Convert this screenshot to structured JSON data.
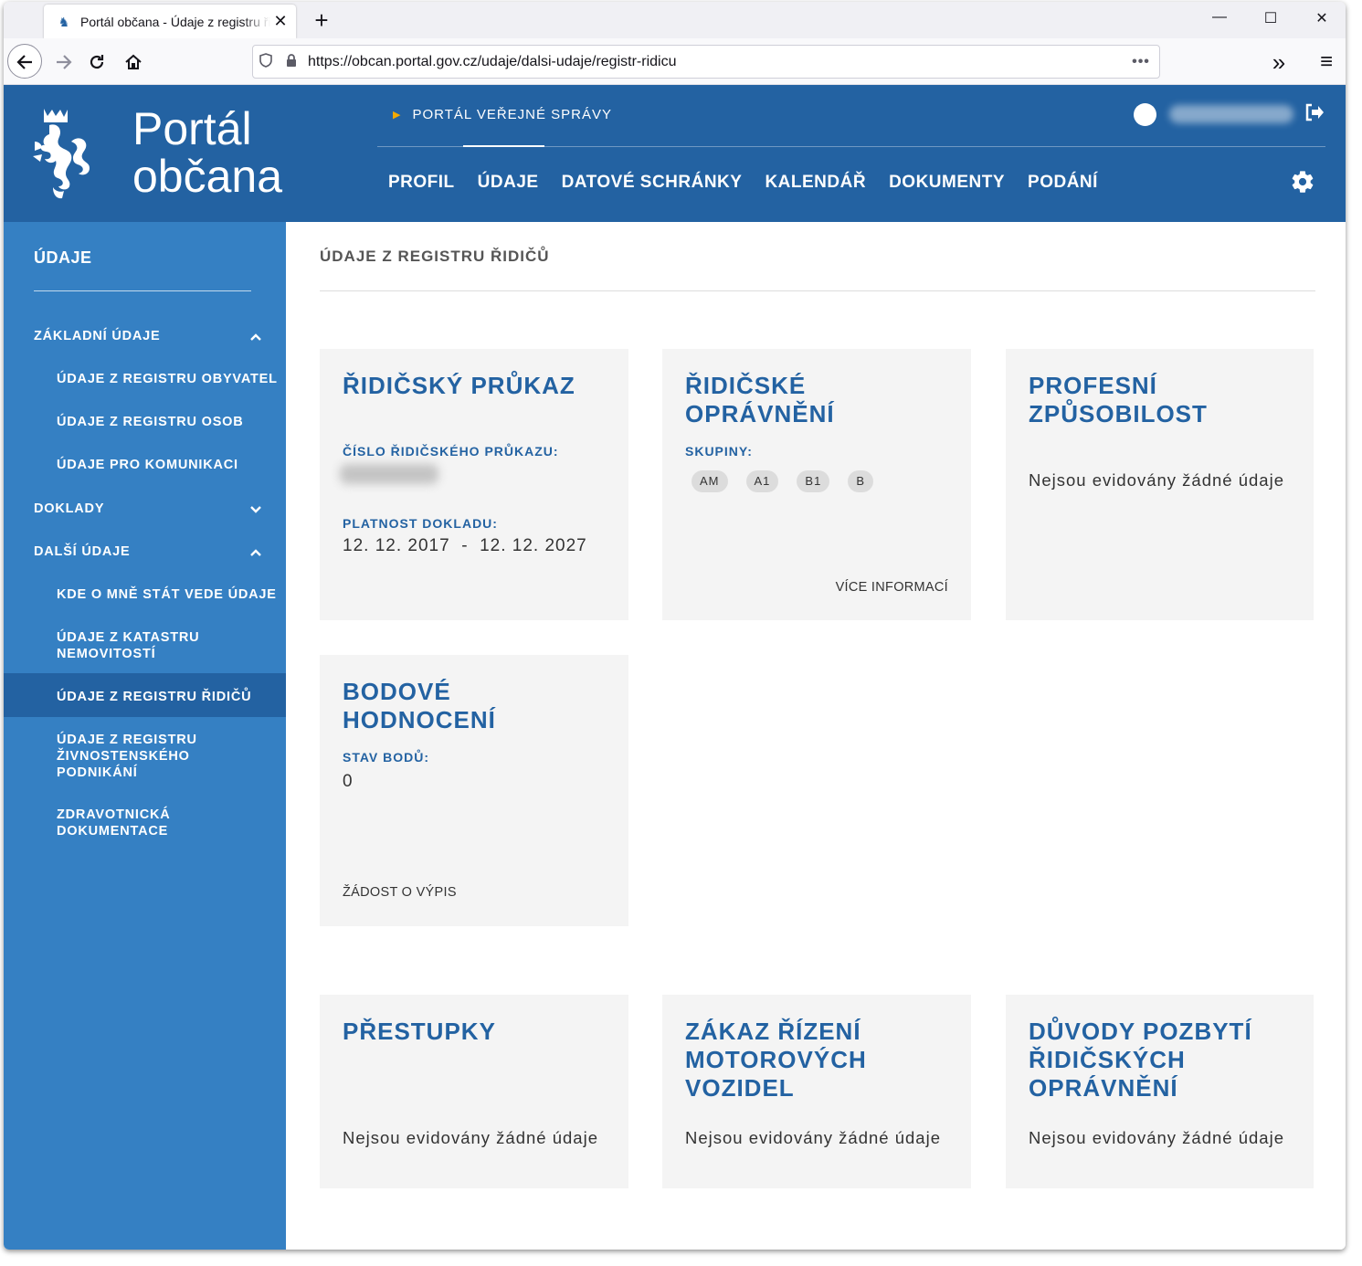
{
  "browser": {
    "tab_title": "Portál občana - Údaje z registru řidičů",
    "new_tab": "+",
    "close_tab": "✕",
    "url": "https://obcan.portal.gov.cz/udaje/dalsi-udaje/registr-ridicu",
    "url_menu": "•••",
    "overflow": "»",
    "menu": "≡",
    "win_min": "—",
    "win_max": "☐",
    "win_close": "✕"
  },
  "header": {
    "logo_line1": "Portál",
    "logo_line2": "občana",
    "portal_link": "PORTÁL VEŘEJNÉ SPRÁVY",
    "nav": [
      "PROFIL",
      "ÚDAJE",
      "DATOVÉ SCHRÁNKY",
      "KALENDÁŘ",
      "DOKUMENTY",
      "PODÁNÍ"
    ]
  },
  "sidebar": {
    "title": "ÚDAJE",
    "items": [
      {
        "label": "ZÁKLADNÍ ÚDAJE",
        "chev": "^"
      },
      {
        "label": "ÚDAJE Z REGISTRU OBYVATEL"
      },
      {
        "label": "ÚDAJE Z REGISTRU OSOB"
      },
      {
        "label": "ÚDAJE PRO KOMUNIKACI"
      },
      {
        "label": "DOKLADY",
        "chev": "⌄"
      },
      {
        "label": "DALŠÍ ÚDAJE",
        "chev": "^"
      },
      {
        "label": "KDE O MNĚ STÁT VEDE ÚDAJE"
      },
      {
        "label": "ÚDAJE Z KATASTRU NEMOVITOSTÍ"
      },
      {
        "label": "ÚDAJE Z REGISTRU ŘIDIČŮ"
      },
      {
        "label": "ÚDAJE Z REGISTRU ŽIVNOSTENSKÉHO PODNIKÁNÍ"
      },
      {
        "label": "ZDRAVOTNICKÁ DOKUMENTACE"
      }
    ]
  },
  "content": {
    "title": "ÚDAJE Z REGISTRU ŘIDIČŮ",
    "cards": {
      "license": {
        "title": "ŘIDIČSKÝ PRŮKAZ",
        "number_label": "ČÍSLO ŘIDIČSKÉHO PRŮKAZU:",
        "validity_label": "PLATNOST DOKLADU:",
        "validity_value": "12. 12. 2017  -  12. 12. 2027"
      },
      "permission": {
        "title": "ŘIDIČSKÉ OPRÁVNĚNÍ",
        "groups_label": "SKUPINY:",
        "groups": [
          "AM",
          "A1",
          "B1",
          "B"
        ],
        "more_link": "VÍCE INFORMACÍ"
      },
      "professional": {
        "title": "PROFESNÍ ZPŮSOBILOST",
        "empty": "Nejsou evidovány žádné údaje"
      },
      "points": {
        "title": "BODOVÉ HODNOCENÍ",
        "status_label": "STAV BODŮ:",
        "status_value": "0",
        "request_link": "ŽÁDOST O VÝPIS"
      },
      "offenses": {
        "title": "PŘESTUPKY",
        "empty": "Nejsou evidovány žádné údaje"
      },
      "ban": {
        "title": "ZÁKAZ ŘÍZENÍ MOTOROVÝCH VOZIDEL",
        "empty": "Nejsou evidovány žádné údaje"
      },
      "reasons": {
        "title": "DŮVODY POZBYTÍ ŘIDIČSKÝCH OPRÁVNĚNÍ",
        "empty": "Nejsou evidovány žádné údaje"
      }
    }
  },
  "colors": {
    "brand_blue": "#2362a2",
    "sidebar_blue": "#3580c3",
    "accent_yellow": "#f2a900",
    "card_bg": "#f4f4f4"
  }
}
